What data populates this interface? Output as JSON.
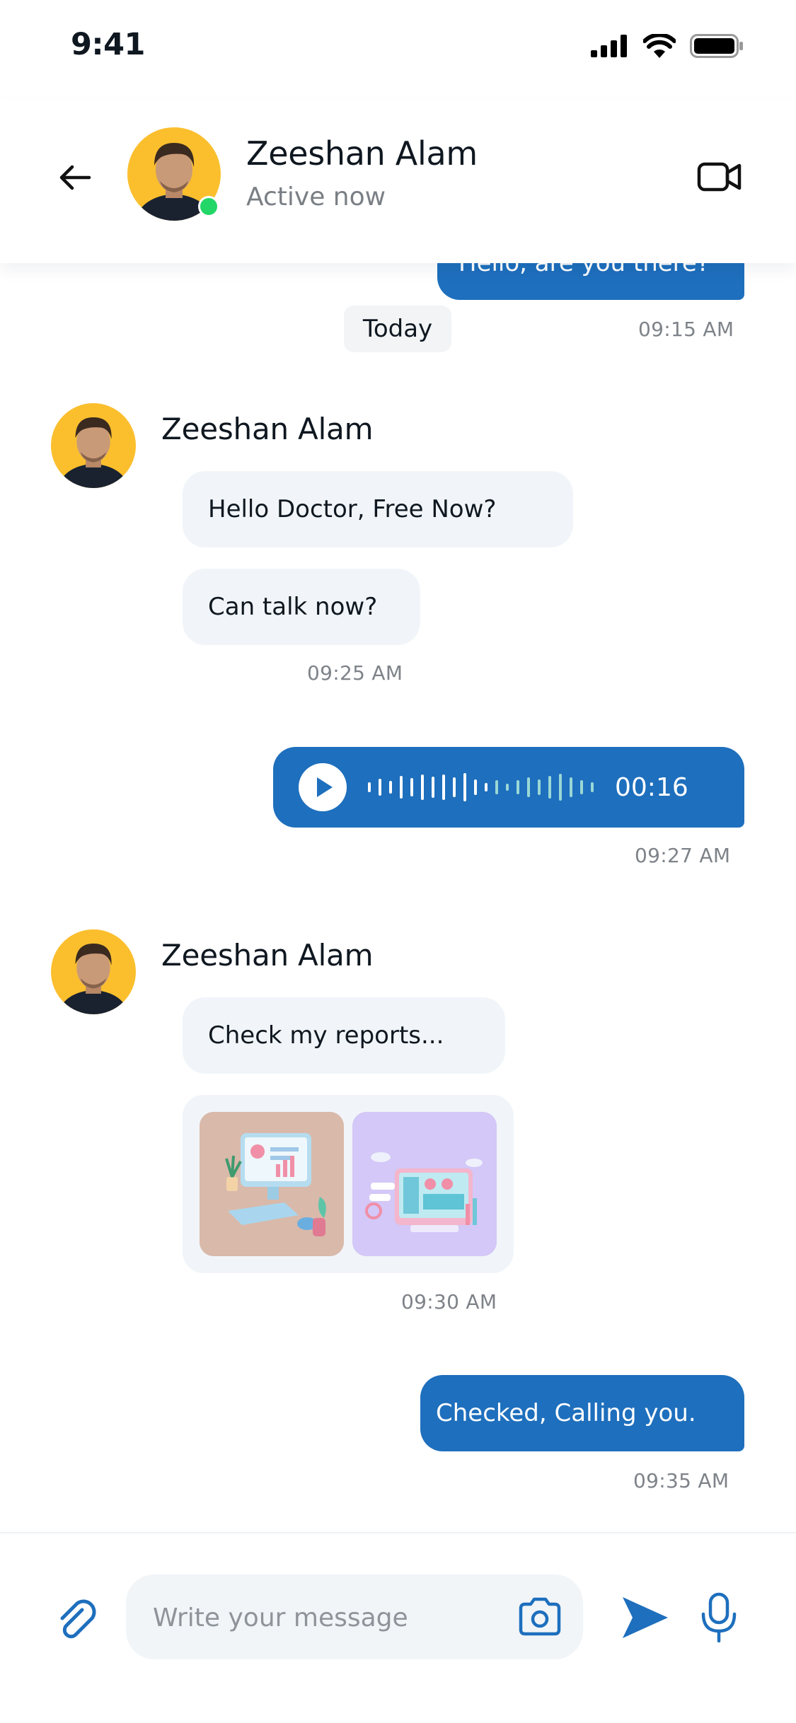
{
  "status_bar": {
    "time": "9:41"
  },
  "header": {
    "name": "Zeeshan Alam",
    "status": "Active now"
  },
  "messages": {
    "top_partial_text": "Hello, are you there?",
    "top_time": "09:15 AM",
    "date_chip": "Today",
    "group1": {
      "sender": "Zeeshan Alam",
      "msg1": "Hello Doctor, Free Now?",
      "msg2": "Can talk now?",
      "time": "09:25 AM"
    },
    "voice": {
      "duration": "00:16",
      "time": "09:27 AM",
      "progress": 0.5
    },
    "group2": {
      "sender": "Zeeshan Alam",
      "msg1": "Check my reports...",
      "time": "09:30 AM"
    },
    "reply": {
      "text": "Checked, Calling you.",
      "time": "09:35 AM"
    }
  },
  "input": {
    "placeholder": "Write your message"
  },
  "colors": {
    "accent": "#1e6fbd",
    "online": "#22d667",
    "avatar_bg": "#fbbf2e"
  }
}
